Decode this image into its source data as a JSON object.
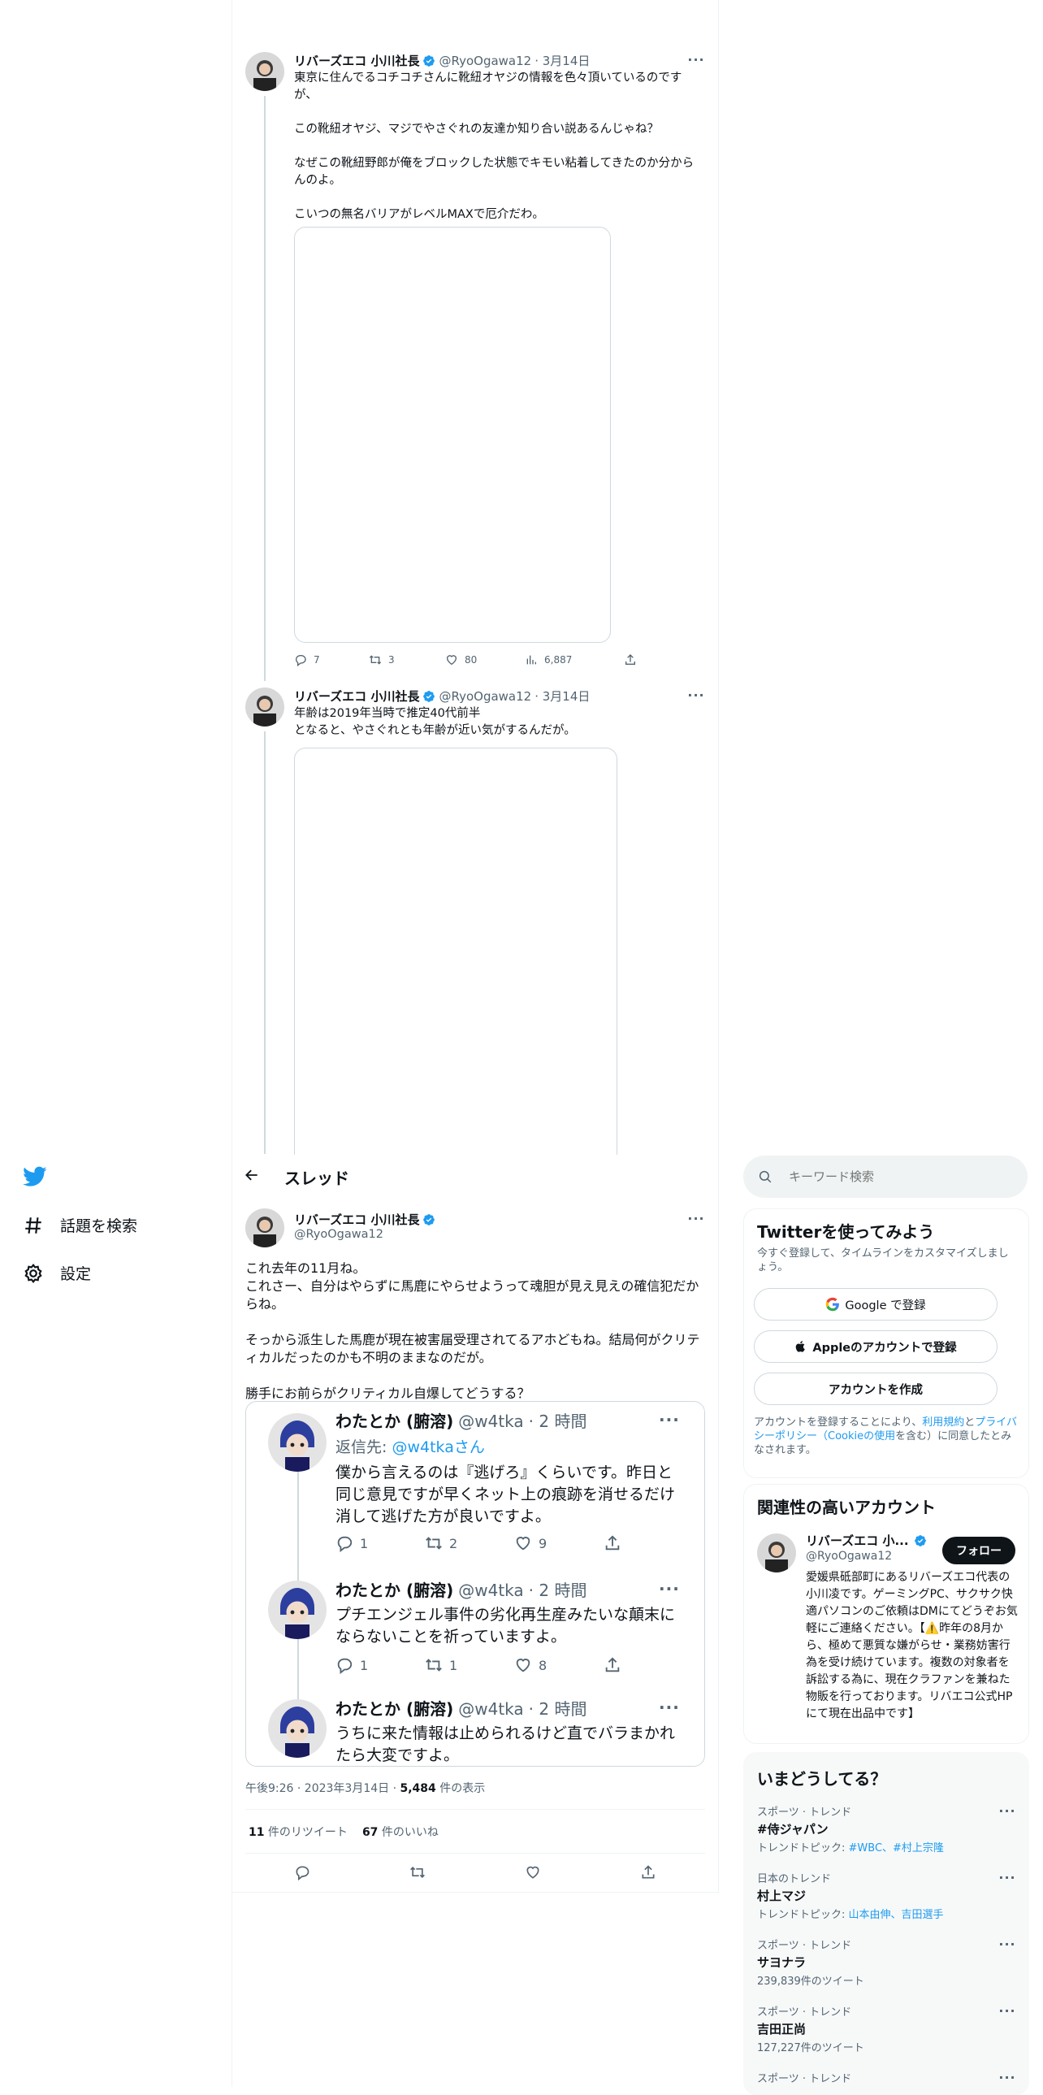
{
  "thread": [
    {
      "name": "リバーズエコ 小川社長",
      "handle": "@RyoOgawa12",
      "date": "· 3月14日",
      "text": "東京に住んでるコチコチさんに靴紐オヤジの情報を色々頂いているのですが、\n\nこの靴紐オヤジ、マジでやさぐれの友達か知り合い説あるんじゃね？\n\nなぜこの靴紐野郎が俺をブロックした状態でキモい粘着してきたのか分からんのよ。\n\nこいつの無名バリアがレベルMAXで厄介だわ。",
      "replies": "7",
      "retweets": "3",
      "likes": "80",
      "views": "6,887"
    },
    {
      "name": "リバーズエコ 小川社長",
      "handle": "@RyoOgawa12",
      "date": "· 3月14日",
      "text": "年齢は2019年当時で推定40代前半\nとなると、やさぐれとも年齢が近い気がするんだが。"
    }
  ],
  "nav": {
    "explore": "話題を検索",
    "settings": "設定"
  },
  "header": {
    "title": "スレッド"
  },
  "main_tweet": {
    "name": "リバーズエコ 小川社長",
    "handle": "@RyoOgawa12",
    "text": "これ去年の11月ね。\nこれさー、自分はやらずに馬鹿にやらせようって魂胆が見え見えの確信犯だからね。\n\nそっから派生した馬鹿が現在被害届受理されてるアホどもね。結局何がクリティカルだったのかも不明のままなのだが。\n\n勝手にお前らがクリティカル自爆してどうする？",
    "timestamp": "午後9:26 · 2023年3月14日 · ",
    "views_count": "5,484",
    "views_label": " 件の表示",
    "retweets_count": "11",
    "retweets_label": " 件のリツイート",
    "likes_count": "67",
    "likes_label": " 件のいいね"
  },
  "quoted": [
    {
      "name": "わたとか (腑溶)",
      "handle": "@w4tka",
      "time": "· 2 時間",
      "reply_to_prefix": "返信先: ",
      "reply_to_handle": "@w4tkaさん",
      "text": "僕から言えるのは『逃げろ』くらいです。昨日と同じ意見ですが早くネット上の痕跡を消せるだけ消して逃げた方が良いですよ。",
      "replies": "1",
      "retweets": "2",
      "likes": "9"
    },
    {
      "name": "わたとか (腑溶)",
      "handle": "@w4tka",
      "time": "· 2 時間",
      "text": "プチエンジェル事件の劣化再生産みたいな顛末にならないことを祈っていますよ。",
      "replies": "1",
      "retweets": "1",
      "likes": "8"
    },
    {
      "name": "わたとか (腑溶)",
      "handle": "@w4tka",
      "time": "· 2 時間",
      "text": "うちに来た情報は止められるけど直でバラまかれたら大変ですよ。"
    }
  ],
  "sidebar": {
    "search_placeholder": "キーワード検索",
    "signup": {
      "title": "Twitterを使ってみよう",
      "subtitle": "今すぐ登録して、タイムラインをカスタマイズしましょう。",
      "google": "Google で登録",
      "apple": "Appleのアカウントで登録",
      "create": "アカウントを作成",
      "terms_pre": "アカウントを登録することにより、",
      "terms_link": "利用規約",
      "terms_and": "と",
      "privacy_link": "プライバシーポリシー",
      "cookie_link": "（Cookieの使用",
      "terms_post": "を含む）に同意したとみなされます。"
    },
    "related": {
      "title": "関連性の高いアカウント",
      "name": "リバーズエコ 小...",
      "handle": "@RyoOgawa12",
      "follow": "フォロー",
      "bio": "愛媛県砥部町にあるリバーズエコ代表の小川凌です。ゲーミングPC、サクサク快適パソコンのご依頼はDMにてどうぞお気軽にご連絡ください。【⚠️昨年の8月から、極めて悪質な嫌がらせ・業務妨害行為を受け続けています。複数の対象者を訴訟する為に、現在クラファンを兼ねた物販を行っております。リバエコ公式HPにて現在出品中です】"
    },
    "trends": {
      "title": "いまどうしてる？",
      "items": [
        {
          "category": "スポーツ · トレンド",
          "name": "#侍ジャパン",
          "detail_prefix": "トレンドトピック: ",
          "detail_links": "#WBC、#村上宗隆"
        },
        {
          "category": "日本のトレンド",
          "name": "村上マジ",
          "detail_prefix": "トレンドトピック: ",
          "detail_links": "山本由伸、吉田選手"
        },
        {
          "category": "スポーツ · トレンド",
          "name": "サヨナラ",
          "detail": "239,839件のツイート"
        },
        {
          "category": "スポーツ · トレンド",
          "name": "吉田正尚",
          "detail": "127,227件のツイート"
        },
        {
          "category": "スポーツ · トレンド"
        }
      ]
    }
  }
}
